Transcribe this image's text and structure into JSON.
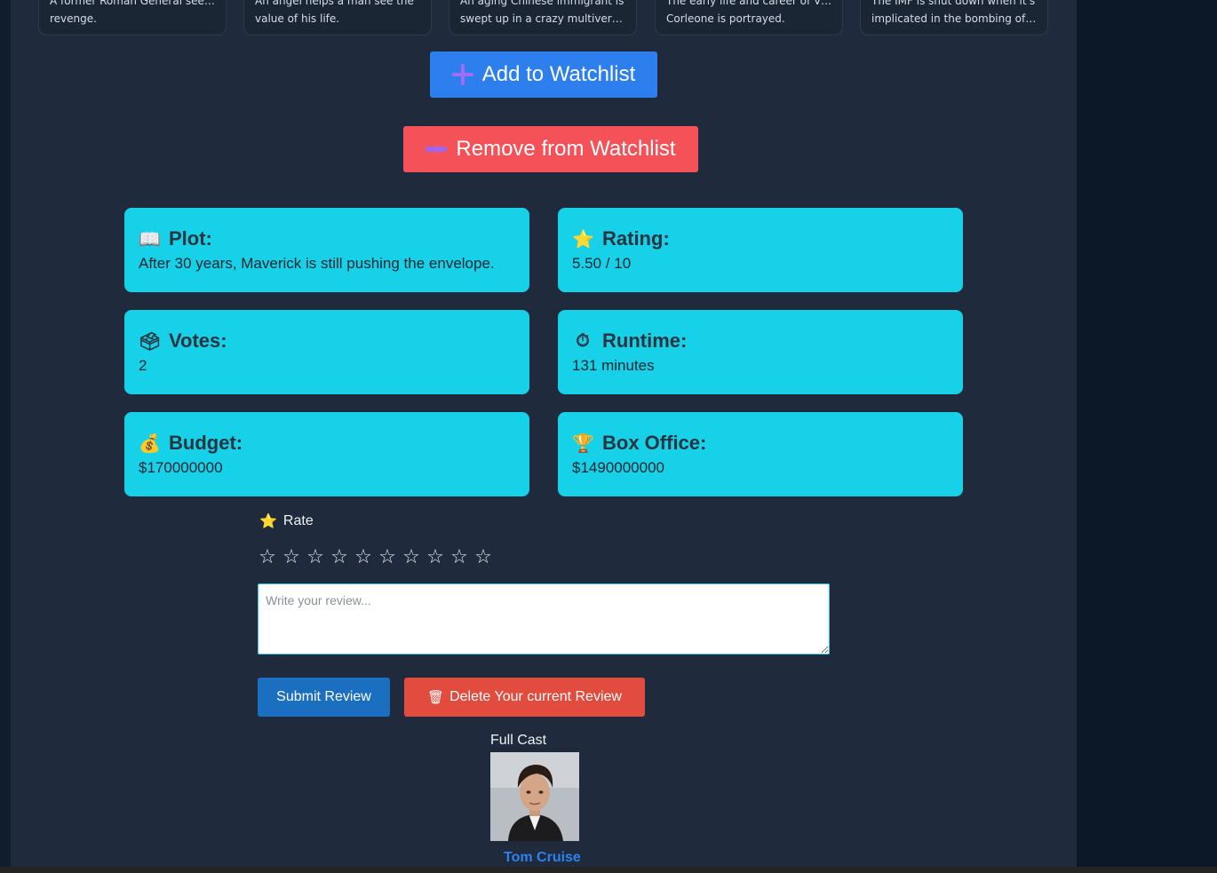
{
  "recommendations": [
    {
      "line1": "A former Roman General seeks",
      "line2": "revenge."
    },
    {
      "line1": "An angel helps a man see the",
      "line2": "value of his life."
    },
    {
      "line1": "An aging Chinese immigrant is",
      "line2": "swept up in a crazy multiverse..."
    },
    {
      "line1": "The early life and career of Vito",
      "line2": "Corleone is portrayed."
    },
    {
      "line1": "The IMF is shut down when it's",
      "line2": "implicated in the bombing of th..."
    }
  ],
  "actions": {
    "add_label": "Add to Watchlist",
    "add_icon": "plus-icon",
    "remove_label": "Remove from Watchlist",
    "remove_icon": "minus-icon"
  },
  "info": {
    "plot": {
      "emoji": "📖",
      "label": "Plot:",
      "value": "After 30 years, Maverick is still pushing the envelope."
    },
    "rating": {
      "emoji": "⭐",
      "label": "Rating:",
      "value": "5.50 / 10"
    },
    "votes": {
      "emoji": "🗳",
      "label": "Votes:",
      "value": "2"
    },
    "runtime": {
      "emoji": "⏱",
      "label": "Runtime:",
      "value": "131 minutes"
    },
    "budget": {
      "emoji": "💰",
      "label": "Budget:",
      "value": "$170000000"
    },
    "box_office": {
      "emoji": "🏆",
      "label": "Box Office:",
      "value": "$1490000000"
    }
  },
  "rate": {
    "emoji": "⭐",
    "label": "Rate",
    "star_glyph": "☆",
    "max_stars": 10,
    "selected": 0
  },
  "review": {
    "placeholder": "Write your review...",
    "submit_label": "Submit Review",
    "delete_emoji": "🗑",
    "delete_label": "Delete Your current Review"
  },
  "cast": {
    "title": "Full Cast",
    "members": [
      {
        "name": "Tom Cruise"
      }
    ]
  },
  "colors": {
    "panel": "#1f2b3c",
    "add_button": "#2d7fee",
    "remove_button": "#f55158",
    "info_card": "#16d1e8",
    "submit_button": "#1b6fc0",
    "delete_button": "#e14c3f",
    "cast_link": "#2c82f0"
  }
}
